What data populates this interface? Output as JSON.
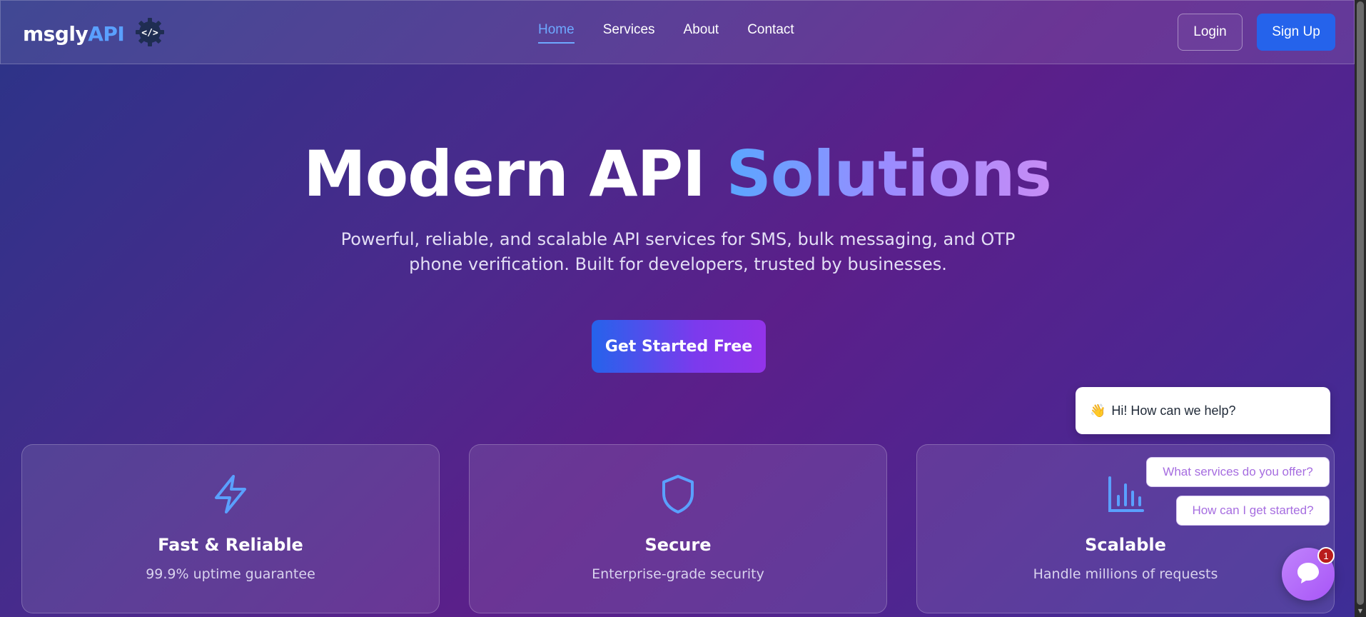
{
  "header": {
    "logo_main": "msgly",
    "logo_accent": "API",
    "logo_badge": "</>",
    "nav": [
      {
        "label": "Home",
        "active": true
      },
      {
        "label": "Services",
        "active": false
      },
      {
        "label": "About",
        "active": false
      },
      {
        "label": "Contact",
        "active": false
      }
    ],
    "login_label": "Login",
    "signup_label": "Sign Up"
  },
  "hero": {
    "title_main": "Modern API",
    "title_accent": "Solutions",
    "subtitle": "Powerful, reliable, and scalable API services for SMS, bulk messaging, and OTP phone verification. Built for developers, trusted by businesses.",
    "cta_label": "Get Started Free"
  },
  "features": [
    {
      "icon": "lightning-icon",
      "title": "Fast & Reliable",
      "desc": "99.9% uptime guarantee"
    },
    {
      "icon": "shield-icon",
      "title": "Secure",
      "desc": "Enterprise-grade security"
    },
    {
      "icon": "bar-chart-icon",
      "title": "Scalable",
      "desc": "Handle millions of requests"
    }
  ],
  "chat": {
    "greeting_emoji": "👋",
    "greeting": "Hi! How can we help?",
    "options": [
      "What services do you offer?",
      "How can I get started?"
    ],
    "unread_count": "1",
    "launcher_icon": "chat-bubble-icon"
  },
  "colors": {
    "accent_blue": "#2563eb",
    "link_active": "#6ea8ff",
    "logo_accent": "#5aa0ff",
    "chat_purple": "#a855f7"
  }
}
